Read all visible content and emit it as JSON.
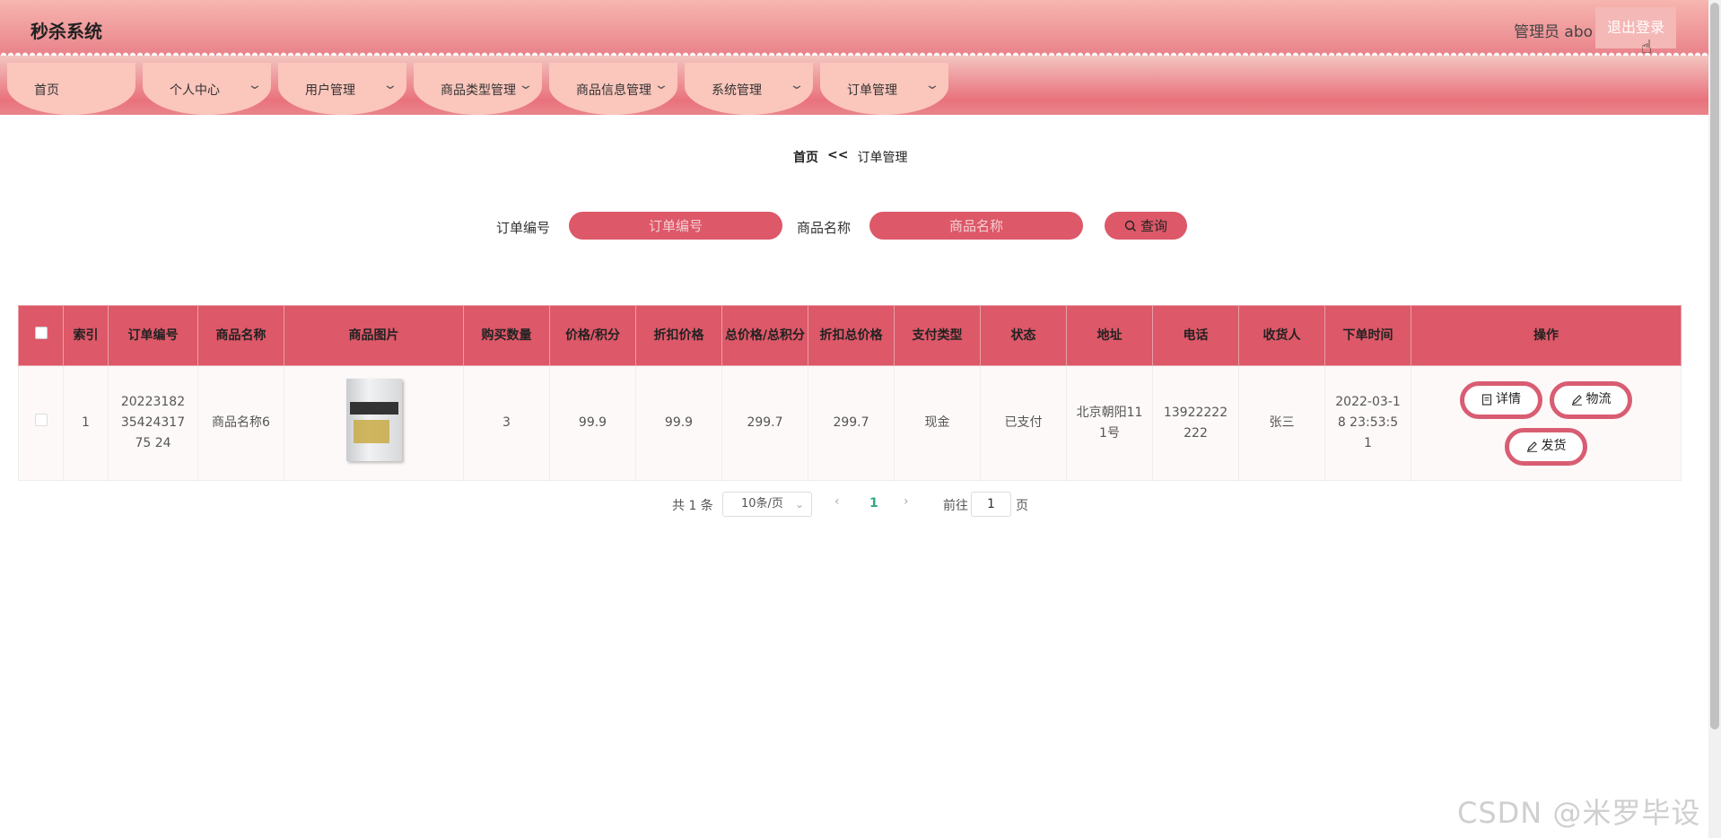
{
  "header": {
    "title": "秒杀系统",
    "user": "管理员 abo",
    "logout": "退出登录"
  },
  "nav": [
    {
      "label": "首页",
      "has_dropdown": false
    },
    {
      "label": "个人中心",
      "has_dropdown": true
    },
    {
      "label": "用户管理",
      "has_dropdown": true
    },
    {
      "label": "商品类型管理",
      "has_dropdown": true
    },
    {
      "label": "商品信息管理",
      "has_dropdown": true
    },
    {
      "label": "系统管理",
      "has_dropdown": true
    },
    {
      "label": "订单管理",
      "has_dropdown": true
    }
  ],
  "breadcrumb": {
    "home": "首页",
    "sep": "<<",
    "current": "订单管理"
  },
  "search": {
    "order_no_label": "订单编号",
    "order_no_placeholder": "订单编号",
    "product_name_label": "商品名称",
    "product_name_placeholder": "商品名称",
    "query_label": "查询"
  },
  "table": {
    "headers": [
      "索引",
      "订单编号",
      "商品名称",
      "商品图片",
      "购买数量",
      "价格/积分",
      "折扣价格",
      "总价格/总积分",
      "折扣总价格",
      "支付类型",
      "状态",
      "地址",
      "电话",
      "收货人",
      "下单时间",
      "操作"
    ],
    "rows": [
      {
        "index": "1",
        "order_no": "202231823542431775 24",
        "product_name": "商品名称6",
        "quantity": "3",
        "price": "99.9",
        "discount_price": "99.9",
        "total": "299.7",
        "discount_total": "299.7",
        "pay_type": "现金",
        "status": "已支付",
        "address": "北京朝阳111号",
        "phone": "13922222222",
        "receiver": "张三",
        "order_time": "2022-03-18 23:53:51"
      }
    ],
    "actions": {
      "detail": "详情",
      "logistics": "物流",
      "ship": "发货"
    }
  },
  "pagination": {
    "total": "共 1 条",
    "page_size": "10条/页",
    "current_page": "1",
    "goto_label": "前往",
    "goto_value": "1",
    "page_suffix": "页"
  },
  "watermark": "CSDN @米罗毕设",
  "colors": {
    "accent": "#dd5868",
    "header_top": "#f7b6b0",
    "nav_item": "#fbc6bc",
    "page_active": "#2fa885"
  }
}
